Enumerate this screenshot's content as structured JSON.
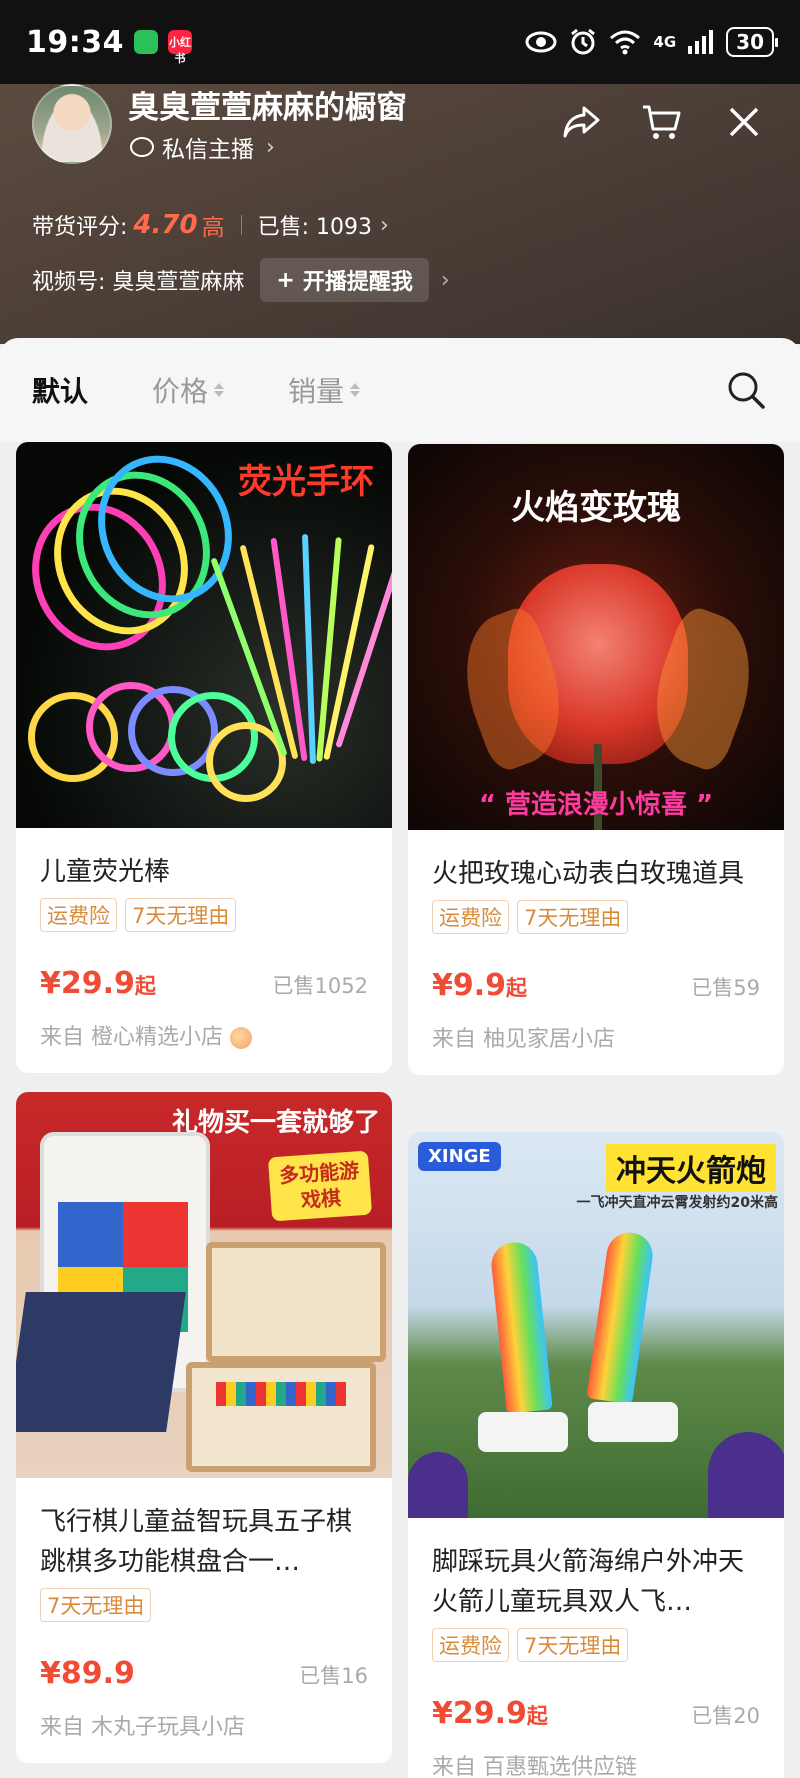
{
  "status_bar": {
    "time": "19:34",
    "battery": "30",
    "network": "4G",
    "app_icons": [
      "wechat-icon",
      "xiaohongshu-icon"
    ],
    "redbook_label": "小红书"
  },
  "header": {
    "shop_name": "臭臭萱萱麻麻的橱窗",
    "private_message": "私信主播",
    "rating_label": "带货评分:",
    "rating_score": "4.70",
    "rating_grade": "高",
    "sold_label": "已售: 1093",
    "video_label": "视频号: 臭臭萱萱麻麻",
    "remind_button": "开播提醒我"
  },
  "sort_bar": {
    "default": "默认",
    "price": "价格",
    "sales": "销量"
  },
  "products": [
    {
      "title": "儿童荧光棒",
      "tags": [
        "运费险",
        "7天无理由"
      ],
      "price": "¥29.9",
      "price_suffix": "起",
      "sold": "已售1052",
      "from": "来自 橙心精选小店",
      "image_caption": "荧光手环"
    },
    {
      "title": "火把玫瑰心动表白玫瑰道具",
      "tags": [
        "运费险",
        "7天无理由"
      ],
      "price": "¥9.9",
      "price_suffix": "起",
      "sold": "已售59",
      "from": "来自 柚见家居小店",
      "image_caption": "火焰变玫瑰",
      "image_subcaption": "“ 营造浪漫小惊喜 ”"
    },
    {
      "title": "飞行棋儿童益智玩具五子棋跳棋多功能棋盘合一…",
      "tags": [
        "7天无理由"
      ],
      "price": "¥89.9",
      "price_suffix": "",
      "sold": "已售16",
      "from": "来自 木丸子玩具小店",
      "image_caption": "礼物买一套就够了",
      "image_badge": "多功能游戏棋"
    },
    {
      "title": "脚踩玩具火箭海绵户外冲天火箭儿童玩具双人飞…",
      "tags": [
        "运费险",
        "7天无理由"
      ],
      "price": "¥29.9",
      "price_suffix": "起",
      "sold": "已售20",
      "from": "来自 百惠甄选供应链",
      "image_caption": "冲天火箭炮",
      "image_brand": "XINGE",
      "image_subcaption": "一飞冲天直冲云霄发射约20米高"
    }
  ]
}
